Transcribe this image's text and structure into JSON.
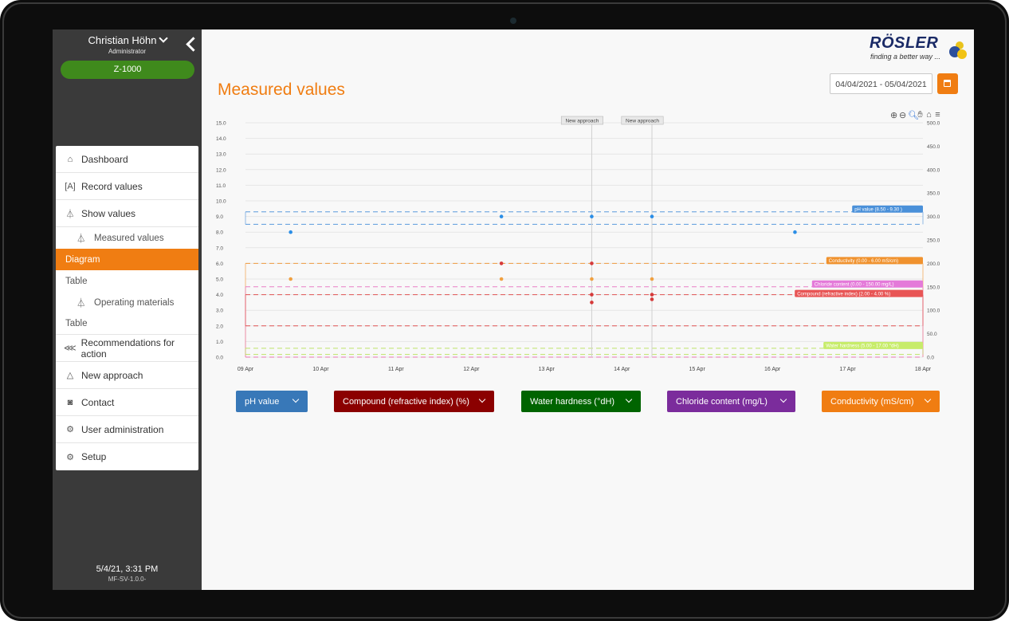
{
  "sidebar": {
    "user_name": "Christian Höhn",
    "user_role": "Administrator",
    "machine": "Z-1000",
    "nav": {
      "dashboard": "Dashboard",
      "record_values": "Record values",
      "show_values": "Show values",
      "measured_values": "Measured values",
      "diagram": "Diagram",
      "table1": "Table",
      "operating_materials": "Operating materials",
      "table2": "Table",
      "recommendations": "Recommendations for action",
      "new_approach": "New approach",
      "contact": "Contact",
      "user_admin": "User administration",
      "setup": "Setup"
    },
    "datetime": "5/4/21, 3:31 PM",
    "version": "MF-SV-1.0.0-"
  },
  "header": {
    "title": "Measured values",
    "logo_word": "RÖSLER",
    "logo_tag": "finding a better way ...",
    "date_range": "04/04/2021 - 05/04/2021"
  },
  "filters": {
    "ph": "pH value",
    "compound": "Compound (refractive index) (%)",
    "water": "Water hardness (°dH)",
    "chloride": "Chloride content (mg/L)",
    "conductivity": "Conductivity (mS/cm)"
  },
  "colors": {
    "orange": "#f07d12",
    "ph": "#3878b8",
    "compound": "#8b0000",
    "water": "#006400",
    "chloride": "#7b2c9c",
    "conductivity": "#f07d12"
  },
  "chart_data": {
    "type": "scatter",
    "x_labels": [
      "09 Apr",
      "10 Apr",
      "11 Apr",
      "12 Apr",
      "13 Apr",
      "14 Apr",
      "15 Apr",
      "16 Apr",
      "17 Apr",
      "18 Apr"
    ],
    "left_axis": {
      "ylim": [
        0,
        15
      ],
      "ticks": [
        "0.0",
        "1.0",
        "2.0",
        "3.0",
        "4.0",
        "5.0",
        "6.0",
        "7.0",
        "8.0",
        "9.0",
        "10.0",
        "11.0",
        "12.0",
        "13.0",
        "14.0",
        "15.0"
      ]
    },
    "right_axis": {
      "ylim": [
        0,
        500
      ],
      "ticks": [
        "0.0",
        "50.0",
        "100.0",
        "150.0",
        "200.0",
        "250.0",
        "300.0",
        "350.0",
        "400.0",
        "450.0",
        "500.0"
      ]
    },
    "markers": [
      {
        "x": 13.6,
        "label": "New approach"
      },
      {
        "x": 14.4,
        "label": "New approach"
      }
    ],
    "bands": [
      {
        "name": "ph",
        "label": "pH value (8.50 - 9.30 )",
        "low": 8.5,
        "high": 9.3,
        "color": "#4a90d9",
        "label_bg": "#4a90d9"
      },
      {
        "name": "conductivity",
        "label": "Conductivity (0.00 - 6.00 mS/cm)",
        "low": 0.0,
        "high": 6.0,
        "color": "#f0922e",
        "label_bg": "#f0922e"
      },
      {
        "name": "chloride",
        "label": "Chloride content (0.00 - 150.00 mg/L)",
        "low": 0.0,
        "high": 4.5,
        "color": "#e870c0",
        "label_bg": "#e47ad9"
      },
      {
        "name": "compound",
        "label": "Compound (refractive index) (2.00 - 4.00 %)",
        "low": 2.0,
        "high": 4.0,
        "color": "#e04545",
        "label_bg": "#e85555"
      },
      {
        "name": "water",
        "label": "Water hardness (5.00 - 17.00 °dH)",
        "low": 0.17,
        "high": 0.57,
        "color": "#b9e05a",
        "label_bg": "#c7ec6a"
      }
    ],
    "series": [
      {
        "name": "pH value",
        "color": "#2b8ee6",
        "points": [
          [
            9.6,
            8.0
          ],
          [
            12.4,
            9.0
          ],
          [
            13.6,
            9.0
          ],
          [
            14.4,
            9.0
          ],
          [
            16.3,
            8.0
          ]
        ]
      },
      {
        "name": "Conductivity",
        "color": "#f0a040",
        "points": [
          [
            9.6,
            5.0
          ],
          [
            12.4,
            5.0
          ],
          [
            13.6,
            5.0
          ],
          [
            14.4,
            5.0
          ]
        ]
      },
      {
        "name": "Compound",
        "color": "#d63a3a",
        "points": [
          [
            12.4,
            6.0
          ],
          [
            13.6,
            6.0
          ],
          [
            13.6,
            4.0
          ],
          [
            13.6,
            3.5
          ],
          [
            14.4,
            4.0
          ],
          [
            14.4,
            3.7
          ]
        ]
      }
    ]
  }
}
